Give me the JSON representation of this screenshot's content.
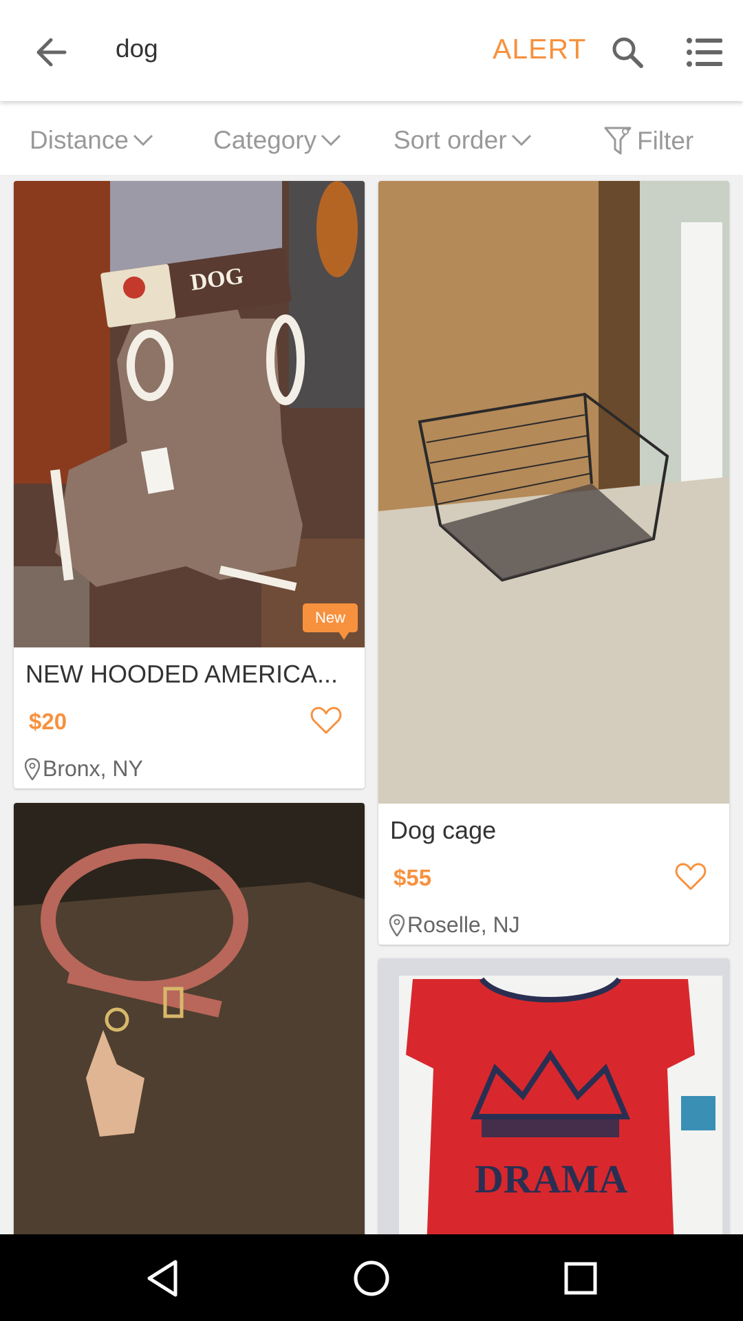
{
  "header": {
    "query": "dog",
    "alert_label": "ALERT",
    "back_icon": "arrow-left-icon",
    "search_icon": "search-icon",
    "menu_icon": "list-menu-icon"
  },
  "filters": {
    "distance_label": "Distance",
    "category_label": "Category",
    "sort_label": "Sort order",
    "filter_label": "Filter"
  },
  "listings": [
    {
      "title": "NEW HOODED AMERICA...",
      "price": "$20",
      "location": "Bronx, NY",
      "badge": "New",
      "photo": "brown hooded dog coat with American Dog Outfitters tag"
    },
    {
      "title": "Dog cage",
      "price": "$55",
      "location": "Roselle, NJ",
      "photo": "black wire dog crate on tile floor"
    },
    {
      "photo": "pink leather dog collar with tag on brown box"
    },
    {
      "photo": "red dog shirt with crown print"
    }
  ],
  "colors": {
    "accent": "#f7913e",
    "text": "#333333",
    "muted": "#999999"
  }
}
